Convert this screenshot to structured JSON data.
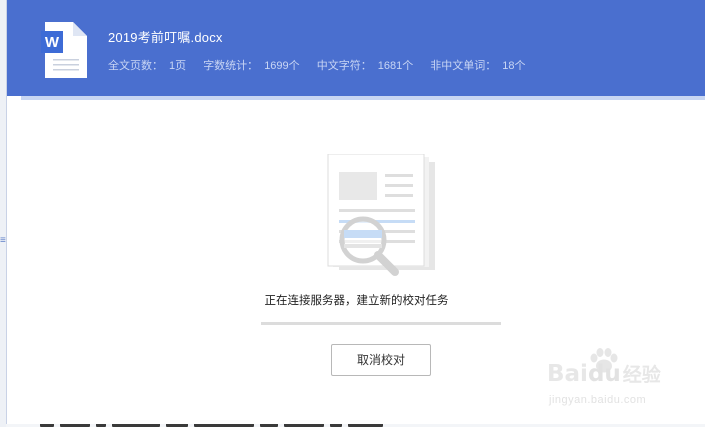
{
  "file": {
    "name": "2019考前叮嘱.docx",
    "stats": [
      {
        "label": "全文页数：",
        "value": "1页"
      },
      {
        "label": "字数统计：",
        "value": "1699个"
      },
      {
        "label": "中文字符：",
        "value": "1681个"
      },
      {
        "label": "非中文单词：",
        "value": "18个"
      }
    ]
  },
  "status": {
    "message": "正在连接服务器，建立新的校对任务",
    "progress": 0
  },
  "buttons": {
    "cancel": "取消校对"
  },
  "watermark": {
    "brand": "Bai",
    "brand_tail": "du",
    "brand_cn": "经验",
    "url": "jingyan.baidu.com"
  },
  "icons": {
    "file": "wps-word-document-icon",
    "illustration": "document-magnifier-icon",
    "watermark_logo": "paw-icon"
  },
  "colors": {
    "header": "#4a6fcf",
    "header_strip": "#c8d6f3",
    "stats_text": "#c9d6f4"
  }
}
